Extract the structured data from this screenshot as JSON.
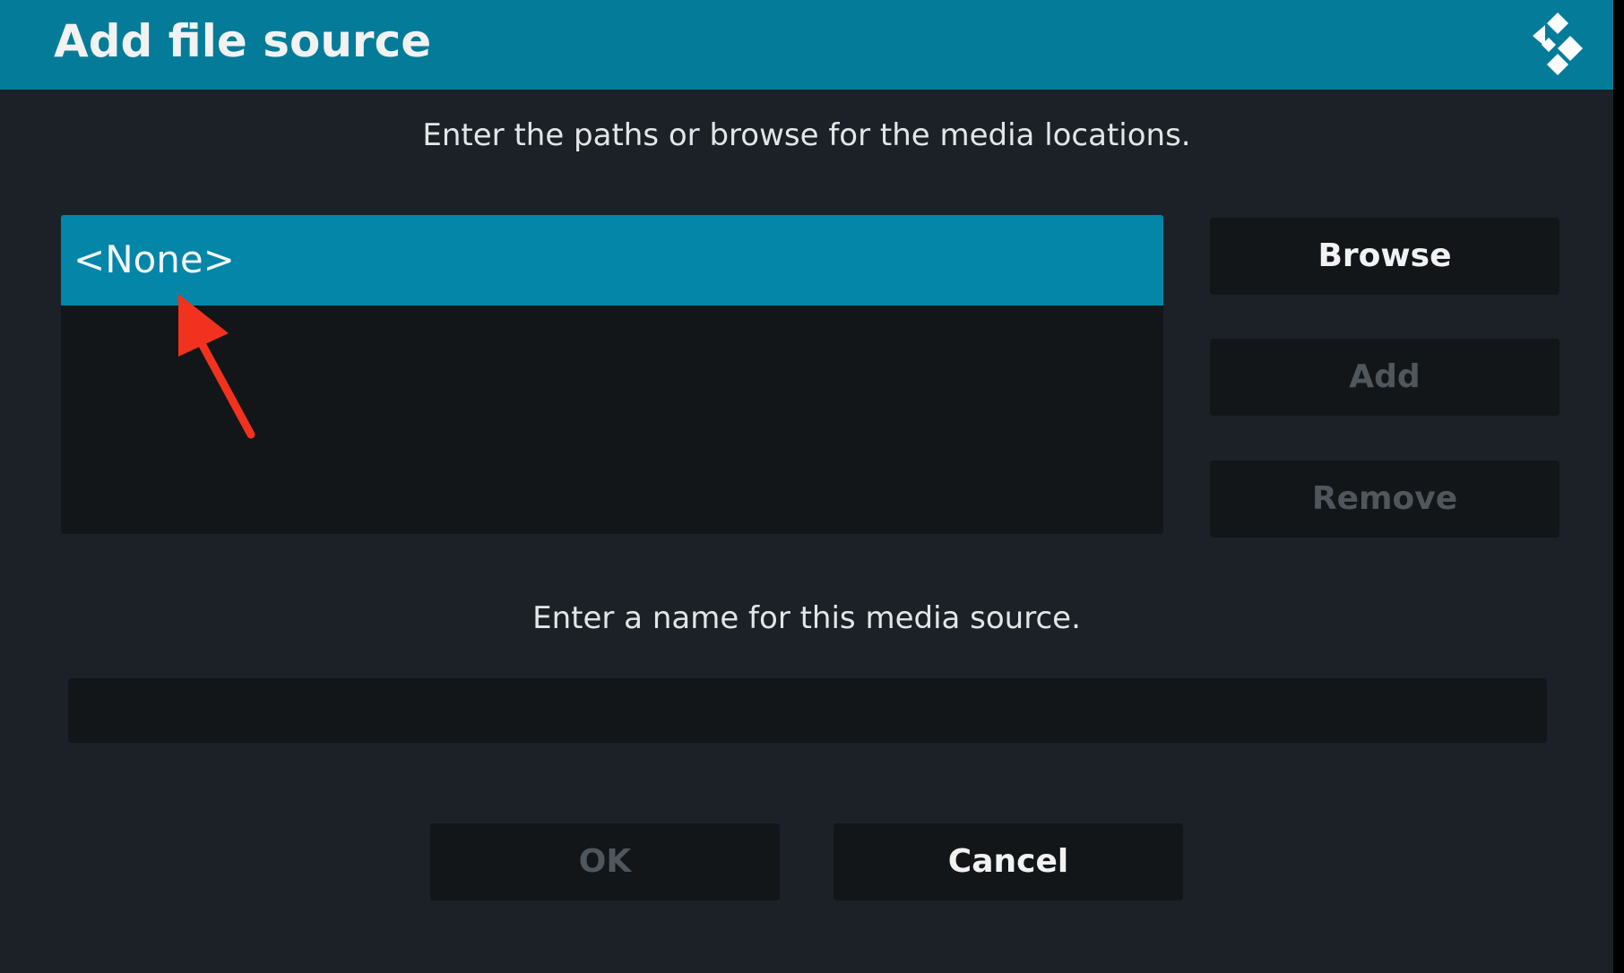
{
  "dialog": {
    "title": "Add file source",
    "logo_icon": "kodi-logo-icon"
  },
  "paths_section": {
    "instruction": "Enter the paths or browse for the media locations.",
    "items": [
      {
        "label": "<None>"
      }
    ],
    "buttons": {
      "browse": "Browse",
      "add": "Add",
      "remove": "Remove"
    }
  },
  "name_section": {
    "instruction": "Enter a name for this media source.",
    "input_value": ""
  },
  "footer": {
    "ok": "OK",
    "cancel": "Cancel"
  },
  "colors": {
    "header": "#047c99",
    "selected_item": "#0386a8",
    "background": "#1b2126",
    "control": "#121619",
    "annotation": "#f2321e"
  }
}
